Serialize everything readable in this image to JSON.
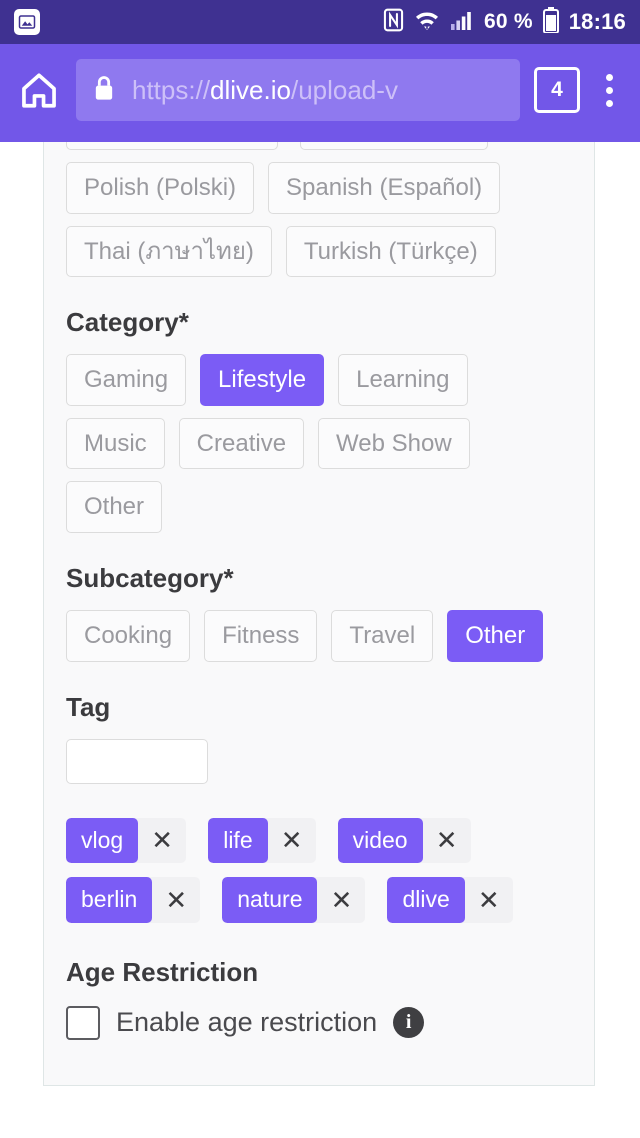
{
  "status_bar": {
    "notification_icon": "image-icon",
    "nfc_icon": "nfc-icon",
    "wifi_icon": "wifi-icon",
    "signal_icon": "signal-bars-icon",
    "battery_percent": "60 %",
    "battery_icon": "battery-icon",
    "clock": "18:16"
  },
  "browser": {
    "home_icon": "home-icon",
    "lock_icon": "lock-icon",
    "url_scheme": "https://",
    "url_host": "dlive.io",
    "url_path": "/upload-v",
    "url_full": "https://dlive.io/upload-v",
    "tab_count": "4",
    "menu_icon": "overflow-menu-icon"
  },
  "page": {
    "language_clipped": [
      "",
      ""
    ],
    "language_buttons": [
      "Polish (Polski)",
      "Spanish (Español)",
      "Thai (ภาษาไทย)",
      "Turkish (Türkçe)"
    ],
    "category": {
      "title": "Category*",
      "options": [
        {
          "label": "Gaming",
          "selected": false
        },
        {
          "label": "Lifestyle",
          "selected": true
        },
        {
          "label": "Learning",
          "selected": false
        },
        {
          "label": "Music",
          "selected": false
        },
        {
          "label": "Creative",
          "selected": false
        },
        {
          "label": "Web Show",
          "selected": false
        },
        {
          "label": "Other",
          "selected": false
        }
      ]
    },
    "subcategory": {
      "title": "Subcategory*",
      "options": [
        {
          "label": "Cooking",
          "selected": false
        },
        {
          "label": "Fitness",
          "selected": false
        },
        {
          "label": "Travel",
          "selected": false
        },
        {
          "label": "Other",
          "selected": true
        }
      ]
    },
    "tag": {
      "title": "Tag",
      "input_value": "",
      "input_placeholder": "",
      "remove_glyph": "✕",
      "chips": [
        "vlog",
        "life",
        "video",
        "berlin",
        "nature",
        "dlive"
      ]
    },
    "age_restriction": {
      "title": "Age Restriction",
      "checkbox_label": "Enable age restriction",
      "checked": false,
      "info_glyph": "i"
    }
  },
  "colors": {
    "status_bar_bg": "#3f3191",
    "browser_bg": "#7257e8",
    "accent": "#7b5cf5",
    "card_bg": "#f9f9fa",
    "border": "#dcdcdc"
  }
}
